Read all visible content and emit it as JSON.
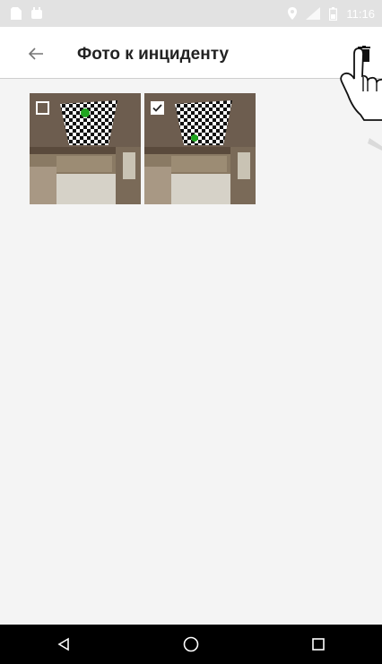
{
  "status_bar": {
    "time": "11:16",
    "icons": [
      "sim-icon",
      "android-icon",
      "location-icon",
      "signal-icon",
      "battery-icon"
    ]
  },
  "app_bar": {
    "title": "Фото к инциденту",
    "back_icon": "arrow-left-icon",
    "action_icon": "trash-icon"
  },
  "photos": [
    {
      "checked": false
    },
    {
      "checked": true
    }
  ],
  "nav_bar": {
    "icons": [
      "back-triangle-icon",
      "home-circle-icon",
      "recents-square-icon"
    ]
  },
  "colors": {
    "status_bar": "#e2e2e2",
    "app_bar": "#ffffff",
    "background": "#f4f4f4",
    "nav_bar": "#000000",
    "marker": "#1fa61f"
  }
}
